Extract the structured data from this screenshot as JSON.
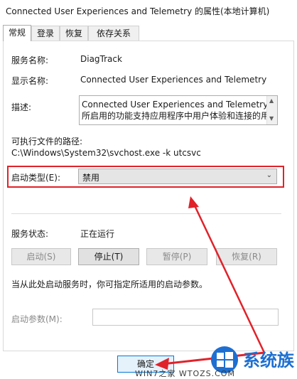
{
  "window": {
    "title": "Connected User Experiences and Telemetry 的属性(本地计算机)"
  },
  "tabs": [
    {
      "label": "常规",
      "active": true
    },
    {
      "label": "登录",
      "active": false
    },
    {
      "label": "恢复",
      "active": false
    },
    {
      "label": "依存关系",
      "active": false
    }
  ],
  "general": {
    "service_name_label": "服务名称:",
    "service_name": "DiagTrack",
    "display_name_label": "显示名称:",
    "display_name": "Connected User Experiences and Telemetry",
    "description_label": "描述:",
    "description_line1": "Connected User Experiences and Telemetry 服务",
    "description_line2": "所启用的功能支持应用程序中用户体验和连接的用户体",
    "exe_path_label": "可执行文件的路径:",
    "exe_path": "C:\\Windows\\System32\\svchost.exe -k utcsvc",
    "startup_type_label": "启动类型(E):",
    "startup_type_value": "禁用",
    "service_status_label": "服务状态:",
    "service_status": "正在运行",
    "buttons": {
      "start": "启动(S)",
      "stop": "停止(T)",
      "pause": "暂停(P)",
      "resume": "恢复(R)"
    },
    "hint": "当从此处启动服务时，你可指定所适用的启动参数。",
    "start_params_label": "启动参数(M):",
    "start_params_value": ""
  },
  "footer": {
    "ok": "确定"
  },
  "icons": {
    "dropdown": "chevron-down-icon",
    "scroll_up": "scroll-up-icon",
    "scroll_down": "scroll-down-icon"
  },
  "annotation": {
    "highlight_color": "#e0222a"
  },
  "watermark": {
    "brand": "系统族",
    "url": "WIN7之家 WTOZS.COM"
  }
}
